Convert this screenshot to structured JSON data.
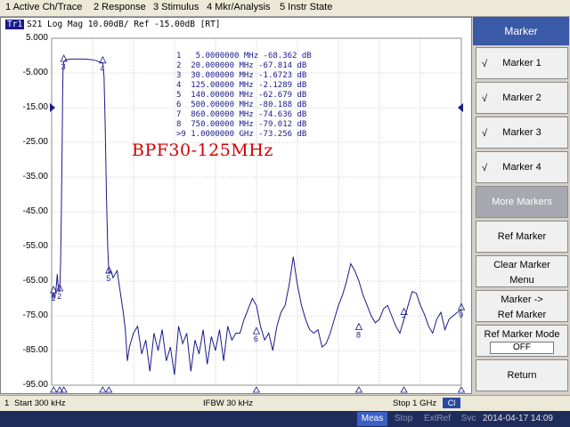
{
  "menu": {
    "items": [
      "1 Active Ch/Trace",
      "2 Response",
      "3 Stimulus",
      "4 Mkr/Analysis",
      "5 Instr State"
    ]
  },
  "trace": {
    "badge": "Tr1",
    "header": "S21 Log Mag 10.00dB/ Ref -15.00dB [RT]"
  },
  "overlay_title": "BPF30-125MHz",
  "marker_table": [
    "1   5.0000000 MHz -68.362 dB",
    "2  20.000000 MHz -67.814 dB",
    "3  30.000000 MHz -1.6723 dB",
    "4  125.00000 MHz -2.1289 dB",
    "5  140.00000 MHz -62.679 dB",
    "6  500.00000 MHz -80.188 dB",
    "7  860.00000 MHz -74.636 dB",
    "8  750.00000 MHz -79.012 dB",
    ">9 1.0000000 GHz -73.256 dB"
  ],
  "colors": {
    "trace": "#1a1a8a",
    "grid": "#9a9a9a",
    "ref_marker": "#1a1a8a",
    "title_red": "#d00000"
  },
  "chart_data": {
    "type": "line",
    "title": "",
    "xlabel": "",
    "ylabel": "",
    "x_start_khz": 300,
    "x_stop_ghz": 1,
    "xlim_mhz": [
      0.3,
      1000
    ],
    "ylim_db": [
      -95,
      5
    ],
    "y_ticks": [
      "5.000",
      "-5.000",
      "-15.00",
      "-25.00",
      "-35.00",
      "-45.00",
      "-55.00",
      "-65.00",
      "-75.00",
      "-85.00",
      "-95.00"
    ],
    "reference_level_db": -15,
    "grid": true,
    "series": [
      {
        "x_mhz": [
          0.3,
          2,
          4,
          5,
          6,
          8,
          10,
          12,
          14,
          16,
          18,
          20,
          22,
          24,
          26,
          27,
          28,
          29,
          30,
          35,
          40,
          50,
          60,
          70,
          80,
          90,
          100,
          110,
          118,
          122,
          125,
          128,
          131,
          134,
          137,
          140,
          145,
          150,
          155,
          160,
          165,
          170,
          175,
          180,
          185,
          190,
          200,
          210,
          220,
          230,
          240,
          250,
          260,
          270,
          280,
          290,
          300,
          310,
          320,
          330,
          340,
          350,
          360,
          370,
          380,
          390,
          400,
          410,
          420,
          430,
          440,
          450,
          460,
          470,
          480,
          490,
          500,
          510,
          520,
          530,
          540,
          550,
          560,
          570,
          580,
          590,
          600,
          610,
          620,
          630,
          640,
          650,
          660,
          670,
          680,
          690,
          700,
          710,
          720,
          730,
          740,
          750,
          760,
          770,
          780,
          790,
          800,
          810,
          820,
          830,
          840,
          850,
          860,
          870,
          880,
          890,
          900,
          910,
          920,
          930,
          940,
          950,
          960,
          970,
          980,
          990,
          1000
        ],
        "y_db": [
          -70,
          -69,
          -68.5,
          -68.4,
          -69,
          -70,
          -68,
          -66,
          -63,
          -66,
          -68,
          -67.8,
          -60,
          -45,
          -25,
          -12,
          -5,
          -2.5,
          -1.7,
          -1.2,
          -1.1,
          -1.0,
          -1.0,
          -1.0,
          -1.0,
          -1.1,
          -1.2,
          -1.5,
          -1.9,
          -2.0,
          -2.1,
          -6,
          -20,
          -40,
          -55,
          -62.7,
          -62,
          -64,
          -63,
          -62,
          -66,
          -70,
          -74,
          -79,
          -88,
          -84,
          -80,
          -78,
          -86,
          -82,
          -91,
          -80,
          -85,
          -79,
          -88,
          -84,
          -92,
          -78,
          -83,
          -80,
          -91,
          -82,
          -86,
          -79,
          -89,
          -81,
          -85,
          -79,
          -88,
          -78,
          -82,
          -80,
          -80,
          -76,
          -73,
          -70,
          -72,
          -78,
          -82,
          -80,
          -85,
          -78,
          -74,
          -72,
          -66,
          -58,
          -66,
          -72,
          -76,
          -79,
          -80,
          -79,
          -84,
          -83,
          -80,
          -76,
          -72,
          -69,
          -65,
          -60,
          -62,
          -65,
          -69,
          -72,
          -75,
          -77,
          -76,
          -73,
          -72,
          -75,
          -78,
          -80,
          -76,
          -72,
          -68,
          -68.5,
          -72,
          -74.6,
          -78,
          -80,
          -76,
          -74,
          -79,
          -76,
          -75,
          -74,
          -73.3
        ]
      }
    ],
    "markers": [
      {
        "id": "1",
        "x_mhz": 5,
        "y_db": -68.362
      },
      {
        "id": "2",
        "x_mhz": 20,
        "y_db": -67.814
      },
      {
        "id": "3",
        "x_mhz": 30,
        "y_db": -1.6723
      },
      {
        "id": "4",
        "x_mhz": 125,
        "y_db": -2.1289
      },
      {
        "id": "5",
        "x_mhz": 140,
        "y_db": -62.679
      },
      {
        "id": "6",
        "x_mhz": 500,
        "y_db": -80.188
      },
      {
        "id": "7",
        "x_mhz": 860,
        "y_db": -74.636
      },
      {
        "id": "8",
        "x_mhz": 750,
        "y_db": -79.012
      },
      {
        "id": "9",
        "x_mhz": 1000,
        "y_db": -73.256
      }
    ]
  },
  "sidebar": {
    "title": "Marker",
    "buttons": [
      {
        "label": "Marker 1",
        "checked": "√"
      },
      {
        "label": "Marker 2",
        "checked": "√"
      },
      {
        "label": "Marker 3",
        "checked": "√"
      },
      {
        "label": "Marker 4",
        "checked": "√"
      },
      {
        "label": "More Markers"
      },
      {
        "label": "Ref Marker"
      },
      {
        "label1": "Clear Marker",
        "label2": "Menu"
      },
      {
        "label1": "Marker ->",
        "label2": "Ref Marker"
      },
      {
        "label1": "Ref Marker Mode",
        "toggle": "OFF"
      },
      {
        "label": "Return"
      }
    ]
  },
  "status": {
    "channel": "1",
    "start": "Start 300 kHz",
    "ifbw": "IFBW 30 kHz",
    "stop": "Stop 1 GHz",
    "ci": "Cl"
  },
  "bottom": {
    "tabs": [
      "Meas",
      "Stop",
      "ExtRef",
      "Svc"
    ],
    "datetime": "2014-04-17 14:09"
  }
}
